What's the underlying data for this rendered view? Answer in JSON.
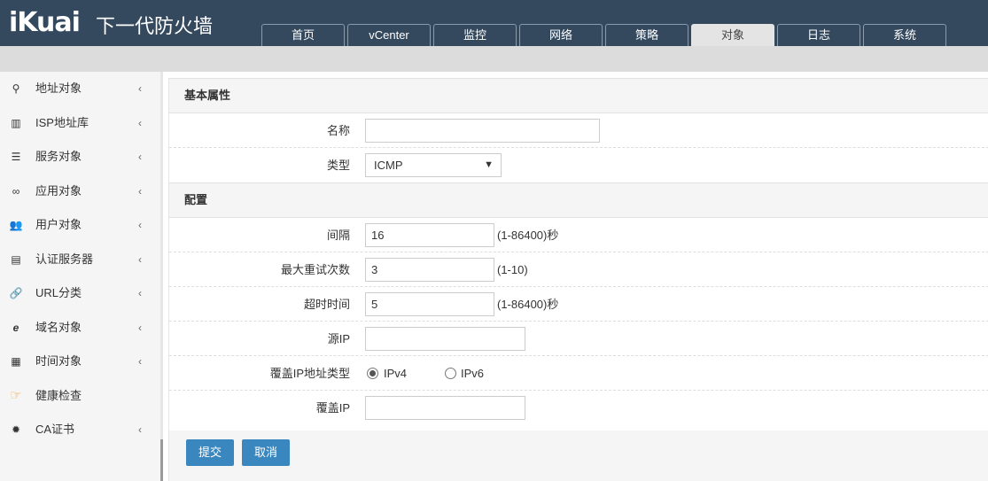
{
  "header": {
    "logo": "iKuai",
    "brand_title": "下一代防火墙",
    "tabs": [
      {
        "label": "首页",
        "active": false
      },
      {
        "label": "vCenter",
        "active": false
      },
      {
        "label": "监控",
        "active": false
      },
      {
        "label": "网络",
        "active": false
      },
      {
        "label": "策略",
        "active": false
      },
      {
        "label": "对象",
        "active": true
      },
      {
        "label": "日志",
        "active": false
      },
      {
        "label": "系统",
        "active": false
      }
    ]
  },
  "sidebar": {
    "items": [
      {
        "label": "地址对象",
        "icon": "map-marker-icon",
        "glyph": "⚲",
        "has_arrow": true
      },
      {
        "label": "ISP地址库",
        "icon": "map-icon",
        "glyph": "▥",
        "has_arrow": true
      },
      {
        "label": "服务对象",
        "icon": "list-icon",
        "glyph": "☰",
        "has_arrow": true
      },
      {
        "label": "应用对象",
        "icon": "gamepad-icon",
        "glyph": "∞",
        "has_arrow": true
      },
      {
        "label": "用户对象",
        "icon": "users-icon",
        "glyph": "👥",
        "has_arrow": true
      },
      {
        "label": "认证服务器",
        "icon": "server-icon",
        "glyph": "▤",
        "has_arrow": true
      },
      {
        "label": "URL分类",
        "icon": "link-icon",
        "glyph": "🔗",
        "has_arrow": true
      },
      {
        "label": "域名对象",
        "icon": "internet-explorer-icon",
        "glyph": "e",
        "has_arrow": true
      },
      {
        "label": "时间对象",
        "icon": "calendar-icon",
        "glyph": "▦",
        "has_arrow": true
      },
      {
        "label": "健康检查",
        "icon": "hand-pointer-icon",
        "glyph": "☞",
        "has_arrow": false
      },
      {
        "label": "CA证书",
        "icon": "certificate-icon",
        "glyph": "✹",
        "has_arrow": true
      }
    ],
    "arrow_glyph": "‹",
    "accent_color": "#f0ad4e"
  },
  "form": {
    "basic_section": "基本属性",
    "name_label": "名称",
    "name_value": "",
    "type_label": "类型",
    "type_value": "ICMP",
    "config_section": "配置",
    "interval_label": "间隔",
    "interval_value": "16",
    "interval_hint": "(1-86400)秒",
    "retry_label": "最大重试次数",
    "retry_value": "3",
    "retry_hint": "(1-10)",
    "timeout_label": "超时时间",
    "timeout_value": "5",
    "timeout_hint": "(1-86400)秒",
    "source_ip_label": "源IP",
    "source_ip_value": "",
    "override_type_label": "覆盖IP地址类型",
    "ipv4_label": "IPv4",
    "ipv6_label": "IPv6",
    "selected_ip_type": "IPv4",
    "override_ip_label": "覆盖IP",
    "override_ip_value": ""
  },
  "actions": {
    "submit_label": "提交",
    "cancel_label": "取消"
  },
  "colors": {
    "header_bg": "#34495e",
    "button_bg": "#3a87c0"
  }
}
